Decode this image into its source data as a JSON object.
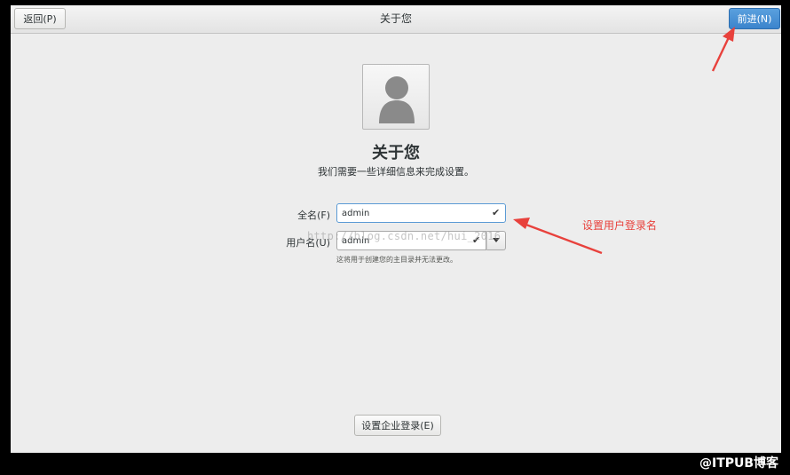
{
  "header": {
    "back_label": "返回(P)",
    "title": "关于您",
    "next_label": "前进(N)"
  },
  "main": {
    "title": "关于您",
    "subtitle": "我们需要一些详细信息来完成设置。",
    "fullname": {
      "label": "全名(F)",
      "value": "admin",
      "check": "✔"
    },
    "username": {
      "label": "用户名(U)",
      "value": "admin",
      "check": "✔",
      "hint": "这将用于创建您的主目录并无法更改。"
    },
    "enterprise_label": "设置企业登录(E)"
  },
  "watermark": "http://blog.csdn.net/hui_2016",
  "annotation": {
    "text": "设置用户登录名",
    "color": "#e8413c"
  },
  "brand": "@ITPUB博客",
  "colors": {
    "accent": "#3b84cc",
    "annotation": "#e8413c"
  },
  "icons": {
    "avatar": "user-avatar-icon",
    "check": "check-icon",
    "dropdown": "chevron-down-icon"
  }
}
